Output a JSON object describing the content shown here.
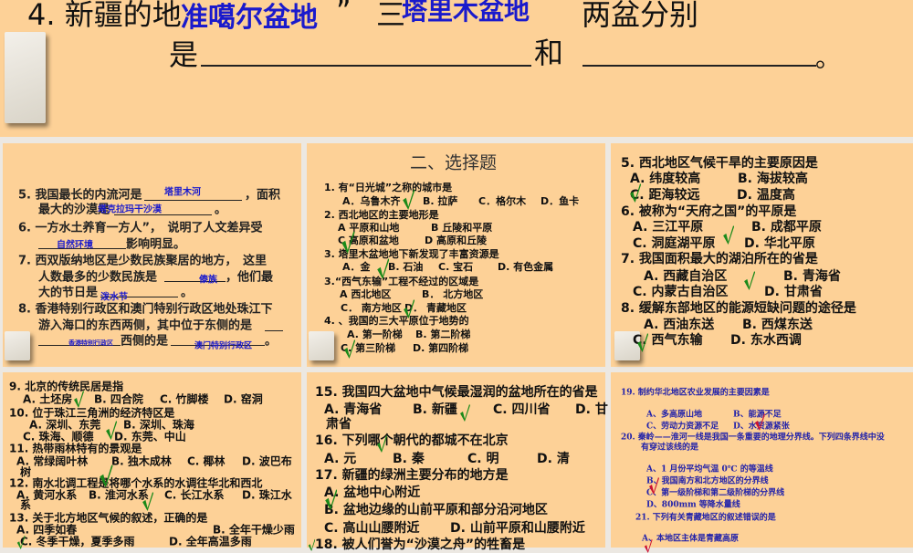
{
  "top": {
    "q4_a": "4. 新疆的地",
    "q4_b": "”",
    "q4_c": "三",
    "q4_d": "两盆分别",
    "q4_e": "是",
    "q4_f": "和",
    "q4_g": "。",
    "answer1": "准噶尔盆地",
    "answer2": "塔里木盆地"
  },
  "fill": {
    "l1a": "5. 我国最长的内流河是",
    "l1b": "，面积",
    "a1": "塔里木河",
    "l2a": "最大的沙漠是",
    "l2b": "。",
    "a2": "塔克拉玛干沙漠",
    "l3": "6. 一方水土养育一方人”，　说明了人文差异受",
    "l4": "影响明显。",
    "a4": "自然环境",
    "l5": "7. 西双版纳地区是少数民族聚居的地方，　这里",
    "l6a": "人数最多的少数民族是",
    "l6b": "，他们最",
    "a6": "傣族",
    "l7a": "大的节日是",
    "l7b": "。",
    "a7": "泼水节",
    "l8": "8. 香港特别行政区和澳门特别行政区地处珠江下",
    "l9": "游入海口的东西两侧，其中位于东侧的是",
    "l10a": "西侧的是",
    "l10b": "。",
    "a10a": "香港特别行政区",
    "a10b": "澳门特别行政区"
  },
  "choice_title": "二、选择题",
  "sections": {
    "mid_top": [
      [
        "1. 有“日光城”之称的城市是"
      ],
      [
        "A．乌鲁木齐",
        "B. 拉萨",
        "C．格尔木",
        "D．鱼卡"
      ],
      [
        "2. 西北地区的主要地形是"
      ],
      [
        "A 平原和山地",
        "B 丘陵和平原"
      ],
      [
        "C 高原和盆地",
        "D 高原和丘陵"
      ],
      [
        "3. 塔里木盆地地下新发现了丰富资源是"
      ],
      [
        "A．金",
        "B. 石油",
        "C. 宝石",
        "D. 有色金属"
      ],
      [
        "3.“西气东输”工程不经过的区域是"
      ],
      [
        "A 西北地区",
        "B． 北方地区"
      ],
      [
        "C． 南方地区",
        "D． 青藏地区"
      ],
      [
        "4. 、我国的三大平原位于地势的"
      ],
      [
        "A. 第一阶梯",
        "B. 第二阶梯"
      ],
      [
        "C. 第三阶梯",
        "D. 第四阶梯"
      ]
    ],
    "right_top": [
      [
        "5. 西北地区气候干旱的主要原因是"
      ],
      [
        "A. 纬度较高",
        "B. 海拔较高"
      ],
      [
        "C. 距海较远",
        "D. 温度高"
      ],
      [
        "6. 被称为“天府之国”的平原是"
      ],
      [
        "A. 三江平原",
        "B. 成都平原"
      ],
      [
        "C. 洞庭湖平原",
        "D. 华北平原"
      ],
      [
        "7. 我国面积最大的湖泊所在的省是"
      ],
      [
        "A. 西藏自治区",
        "B. 青海省"
      ],
      [
        "C. 内蒙古自治区",
        "D. 甘肃省"
      ],
      [
        "8. 缓解东部地区的能源短缺问题的途径是"
      ],
      [
        "A. 西油东送",
        "B. 西煤东送"
      ],
      [
        "C. 西气东输",
        "D. 东水西调"
      ]
    ],
    "left_bottom": [
      [
        "9. 北京的传统民居是指"
      ],
      [
        "A. 土坯房",
        "B. 四合院",
        "C. 竹脚楼",
        "D. 窑洞"
      ],
      [
        "10. 位于珠江三角洲的经济特区是"
      ],
      [
        "A. 深圳、东莞",
        "B. 深圳、珠海"
      ],
      [
        "C. 珠海、顺德",
        "D. 东莞、中山"
      ],
      [
        "11. 热带雨林特有的景观是"
      ],
      [
        "A. 常绿阔叶林",
        "B. 独木成林",
        "C. 椰林",
        "D. 波巴布"
      ],
      [
        "树"
      ],
      [
        "12. 南水北调工程是将哪个水系的水调往华北和西北"
      ],
      [
        "A. 黄河水系",
        "B. 淮河水系",
        "C. 长江水系",
        "D. 珠江水"
      ],
      [
        "系"
      ],
      [
        "13. 关于北方地区气候的叙述，正确的是"
      ],
      [
        "A. 四季如春",
        "B. 全年干燥少雨"
      ],
      [
        "C. 冬季干燥，夏季多雨",
        "D. 全年高温多雨"
      ]
    ],
    "mid_bottom": [
      [
        "15. 我国四大盆地中气候最湿润的盆地所在的省是"
      ],
      [
        "A. 青海省",
        "B. 新疆",
        "C. 四川省",
        "D. 甘"
      ],
      [
        "肃省"
      ],
      [
        "16. 下列哪个朝代的都城不在北京"
      ],
      [
        "A. 元",
        "B. 秦",
        "C. 明",
        "D. 清"
      ],
      [
        "17. 新疆的绿洲主要分布的地方是"
      ],
      [
        "A. 盆地中心附近"
      ],
      [
        "B. 盆地边缘的山前平原和部分沿河地区"
      ],
      [
        "C. 高山山腰附近",
        "D. 山前平原和山腰附近"
      ],
      [
        "18. 被人们誉为“沙漠之舟”的牲畜是"
      ]
    ],
    "right_bottom": [
      [
        "19. 制约华北地区农业发展的主要因素是"
      ],
      [
        "A、多高原山地",
        "B、能源不足"
      ],
      [
        "C、劳动力资源不足",
        "D、水资源紧张"
      ],
      [
        "20. 秦岭——淮河一线是我国一条重要的地理分界线。下列四条界线中没"
      ],
      [
        "有穿过该线的是"
      ],
      [
        "A、1 月份平均气温 0℃ 的等温线"
      ],
      [
        "B、我国南方和北方地区的分界线"
      ],
      [
        "C、第一级阶梯和第二级阶梯的分界线"
      ],
      [
        "D、800mm 等降水量线"
      ],
      [
        "21. 下列有关青藏地区的叙述错误的是"
      ],
      [
        "A、本地区主体是青藏高原"
      ]
    ]
  },
  "colors": {
    "panel": "#fdd197",
    "answer": "#1a1acc",
    "check_green": "#1a8a1a",
    "check_red": "#cc1030"
  }
}
